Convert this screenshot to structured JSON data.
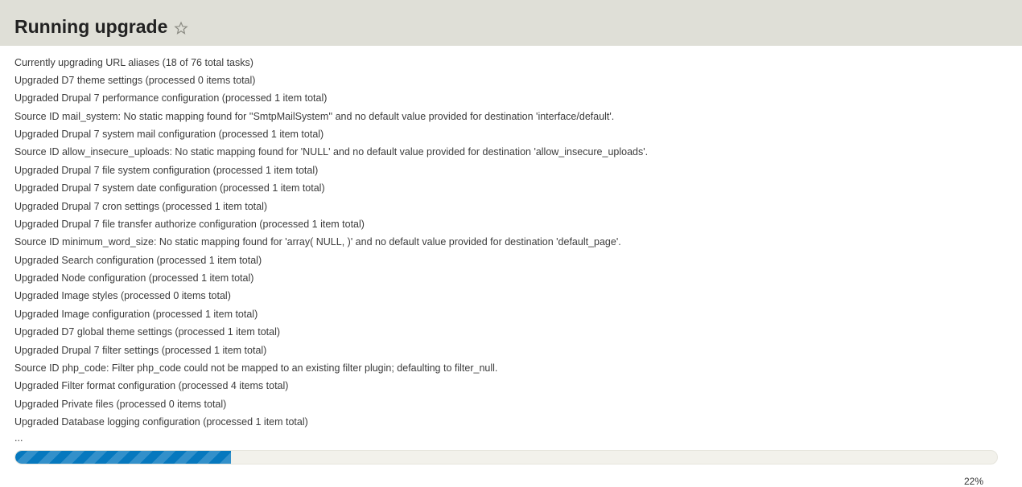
{
  "header": {
    "title": "Running upgrade"
  },
  "log_lines": [
    "Currently upgrading URL aliases (18 of 76 total tasks)",
    "Upgraded D7 theme settings (processed 0 items total)",
    "Upgraded Drupal 7 performance configuration (processed 1 item total)",
    "Source ID mail_system: No static mapping found for ''SmtpMailSystem'' and no default value provided for destination 'interface/default'.",
    "Upgraded Drupal 7 system mail configuration (processed 1 item total)",
    "Source ID allow_insecure_uploads: No static mapping found for 'NULL' and no default value provided for destination 'allow_insecure_uploads'.",
    "Upgraded Drupal 7 file system configuration (processed 1 item total)",
    "Upgraded Drupal 7 system date configuration (processed 1 item total)",
    "Upgraded Drupal 7 cron settings (processed 1 item total)",
    "Upgraded Drupal 7 file transfer authorize configuration (processed 1 item total)",
    "Source ID minimum_word_size: No static mapping found for 'array( NULL, )' and no default value provided for destination 'default_page'.",
    "Upgraded Search configuration (processed 1 item total)",
    "Upgraded Node configuration (processed 1 item total)",
    "Upgraded Image styles (processed 0 items total)",
    "Upgraded Image configuration (processed 1 item total)",
    "Upgraded D7 global theme settings (processed 1 item total)",
    "Upgraded Drupal 7 filter settings (processed 1 item total)",
    "Source ID php_code: Filter php_code could not be mapped to an existing filter plugin; defaulting to filter_null.",
    "Upgraded Filter format configuration (processed 4 items total)",
    "Upgraded Private files (processed 0 items total)",
    "Upgraded Database logging configuration (processed 1 item total)"
  ],
  "ellipsis": "...",
  "progress": {
    "percent_value": 22,
    "percent_label": "22%"
  }
}
